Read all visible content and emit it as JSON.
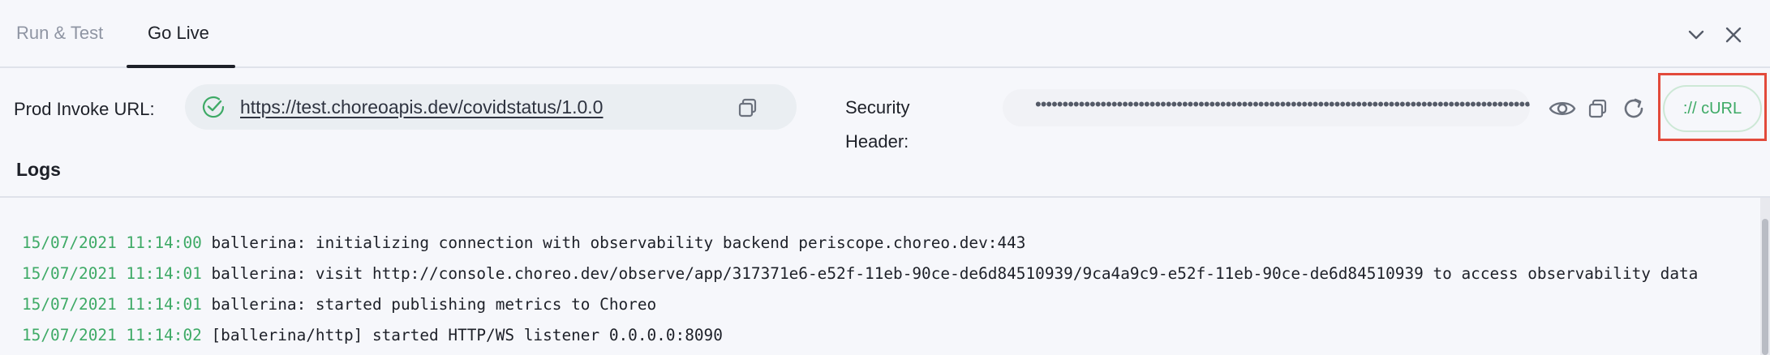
{
  "tabs": [
    {
      "label": "Run & Test",
      "active": false
    },
    {
      "label": "Go Live",
      "active": true
    }
  ],
  "window": {
    "collapse_icon": "chevron-down-icon",
    "close_icon": "close-icon"
  },
  "invoke": {
    "label": "Prod Invoke URL:",
    "url": "https://test.choreoapis.dev/covidstatus/1.0.0",
    "status_icon": "check-circle-icon",
    "copy_icon": "copy-icon"
  },
  "security": {
    "label": "Security\nHeader:",
    "masked_value": "•••••••••••••••••••••••••••••••••••••••••••••••••••••••••••••••••••••••••••••••••••••••••••••••",
    "show_icon": "eye-icon",
    "copy_icon": "copy-icon",
    "regenerate_icon": "refresh-icon"
  },
  "curl": {
    "label": ":// cURL"
  },
  "logs": {
    "title": "Logs",
    "lines": [
      {
        "timestamp": "15/07/2021 11:14:00",
        "message": "ballerina: initializing connection with observability backend periscope.choreo.dev:443"
      },
      {
        "timestamp": "15/07/2021 11:14:01",
        "message": "ballerina: visit http://console.choreo.dev/observe/app/317371e6-e52f-11eb-90ce-de6d84510939/9ca4a9c9-e52f-11eb-90ce-de6d84510939 to access observability data"
      },
      {
        "timestamp": "15/07/2021 11:14:01",
        "message": "ballerina: started publishing metrics to Choreo"
      },
      {
        "timestamp": "15/07/2021 11:14:02",
        "message": "[ballerina/http] started HTTP/WS listener 0.0.0.0:8090"
      }
    ]
  },
  "colors": {
    "accent": "#3eaa66",
    "highlight": "#e24a3b",
    "text": "#1d2028",
    "muted": "#8f95a3"
  }
}
